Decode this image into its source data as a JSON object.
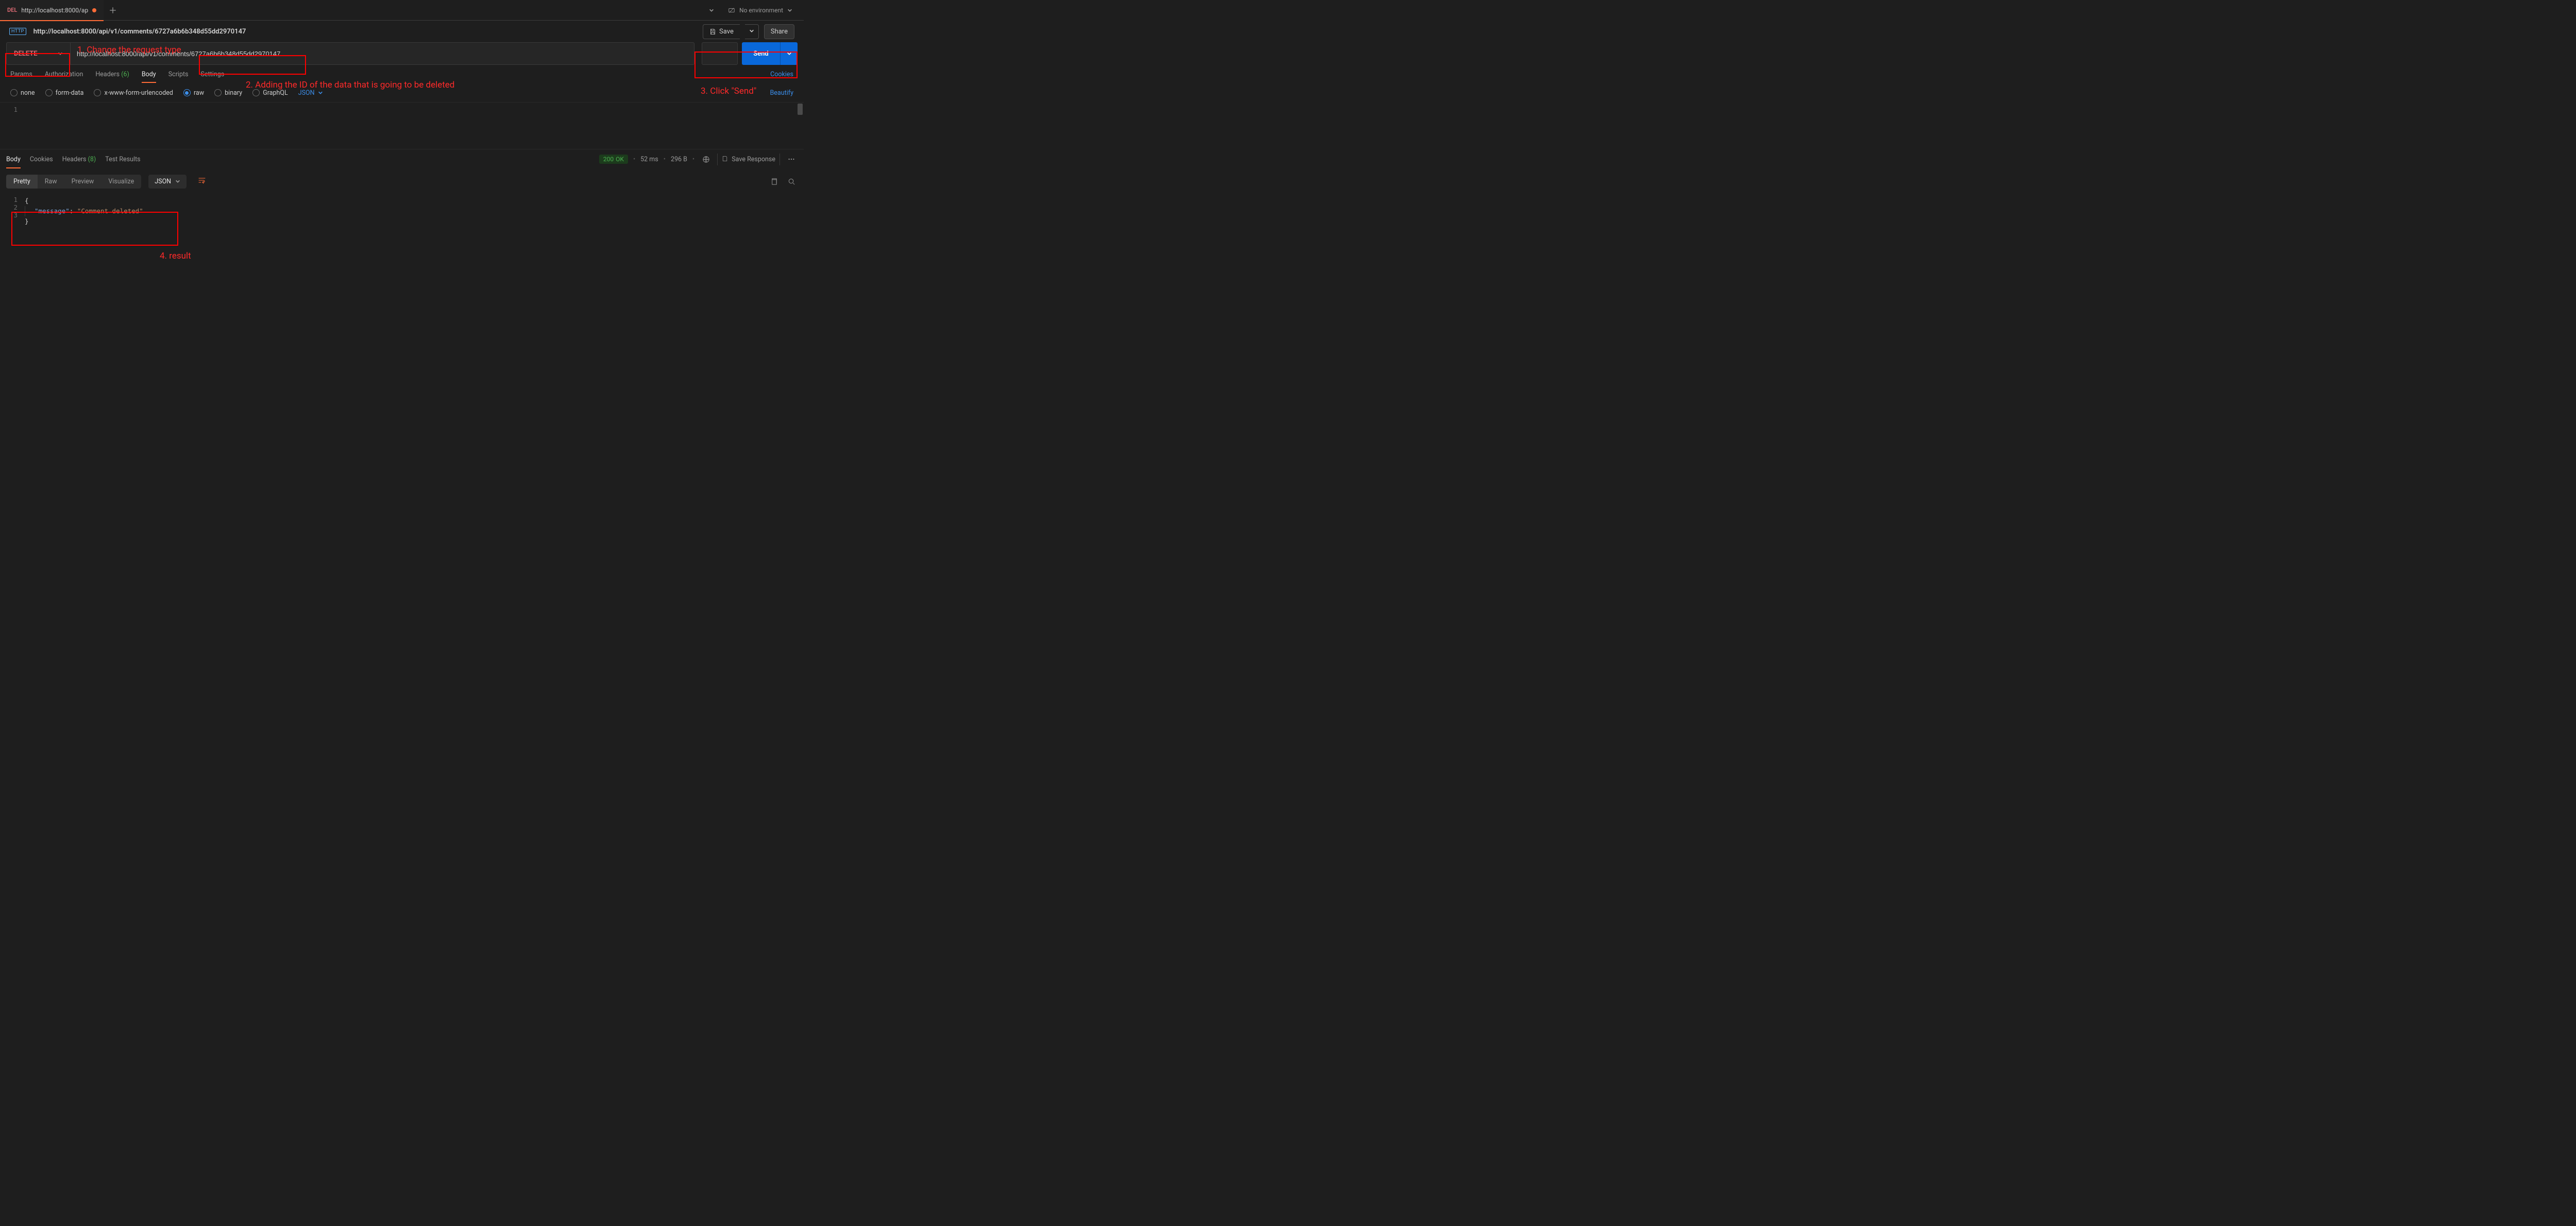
{
  "tab": {
    "method": "DEL",
    "title": "http://localhost:8000/ap"
  },
  "env": {
    "label": "No environment"
  },
  "breadcrumb": {
    "title": "http://localhost:8000/api/v1/comments/6727a6b6b348d55dd2970147"
  },
  "actions": {
    "save": "Save",
    "share": "Share",
    "send": "Send"
  },
  "request": {
    "method": "DELETE",
    "url": "http://localhost:8000/api/v1/comments/6727a6b6b348d55dd2970147"
  },
  "req_tabs": {
    "params": "Params",
    "auth": "Authorization",
    "headers": "Headers",
    "headers_count": "(6)",
    "body": "Body",
    "scripts": "Scripts",
    "settings": "Settings",
    "cookies": "Cookies"
  },
  "body_types": {
    "none": "none",
    "form": "form-data",
    "urlenc": "x-www-form-urlencoded",
    "raw": "raw",
    "binary": "binary",
    "graphql": "GraphQL",
    "lang": "JSON",
    "beautify": "Beautify"
  },
  "req_editor": {
    "line1_no": "1"
  },
  "resp_tabs": {
    "body": "Body",
    "cookies": "Cookies",
    "headers": "Headers",
    "headers_count": "(8)",
    "tests": "Test Results"
  },
  "resp_meta": {
    "status_code": "200",
    "status_text": "OK",
    "time": "52 ms",
    "size": "296 B",
    "save": "Save Response"
  },
  "resp_toolbar": {
    "pretty": "Pretty",
    "raw": "Raw",
    "preview": "Preview",
    "visualize": "Visualize",
    "fmt": "JSON"
  },
  "resp_body": {
    "l1": "1",
    "l2": "2",
    "l3": "3",
    "open": "{",
    "key": "\"message\"",
    "colon": ":",
    "val": "\"Comment deleted\"",
    "close": "}"
  },
  "annotations": {
    "a1": "1. Change the request type",
    "a2": "2. Adding the ID of the data that is going to be deleted",
    "a3": "3. Click \"Send\"",
    "a4": "4. result"
  }
}
